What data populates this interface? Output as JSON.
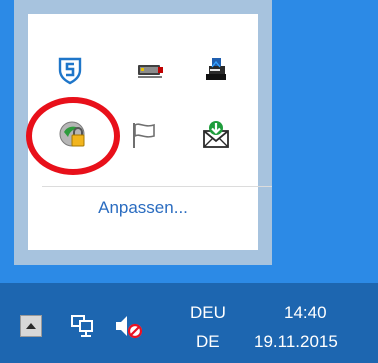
{
  "overflow_panel": {
    "customize_label": "Anpassen...",
    "icons_row1": [
      "shield-s-icon",
      "network-adapter-icon",
      "printer-icon"
    ],
    "icons_row2": [
      "vpn-lock-icon",
      "action-center-flag-icon",
      "mail-download-icon"
    ]
  },
  "taskbar": {
    "language_line1": "DEU",
    "language_line2": "DE",
    "time": "14:40",
    "date": "19.11.2015",
    "icons": [
      "show-hidden-icons-chevron-icon",
      "network-icon",
      "speaker-muted-icon"
    ]
  },
  "colors": {
    "desktop": "#2c8ae6",
    "taskbar": "#1d66b0",
    "panel_border": "#a7c3de",
    "highlight": "#e8101a",
    "link": "#2a6cc0"
  }
}
